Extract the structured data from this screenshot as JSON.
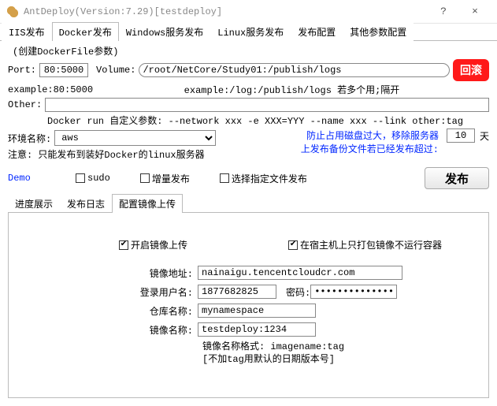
{
  "window": {
    "title": "AntDeploy(Version:7.29)[testdeploy]"
  },
  "main_tabs": [
    "IIS发布",
    "Docker发布",
    "Windows服务发布",
    "Linux服务发布",
    "发布配置",
    "其他参数配置"
  ],
  "docker": {
    "dockerfile_heading": "(创建DockerFile参数)",
    "port_label": "Port:",
    "port_value": "80:5000",
    "port_example": "example:80:5000",
    "volume_label": "Volume:",
    "volume_value": "/root/NetCore/Study01:/publish/logs",
    "volume_example": "example:/log:/publish/logs  若多个用;隔开",
    "rollback": "回滚",
    "other_label": "Other:",
    "other_value": "",
    "other_hint": "Docker run 自定义参数:  --network xxx -e XXX=YYY --name xxx --link other:tag",
    "env_label": "环境名称:",
    "env_value": "aws",
    "env_note": "注意: 只能发布到装好Docker的linux服务器",
    "disk_note1": "防止占用磁盘过大，移除服务器",
    "disk_note2": "上发布备份文件若已经发布超过:",
    "days_value": "10",
    "days_unit": "天",
    "demo": "Demo",
    "sudo": "sudo",
    "incremental": "增量发布",
    "select_files": "选择指定文件发布",
    "publish": "发布"
  },
  "sub_tabs": [
    "进度展示",
    "发布日志",
    "配置镜像上传"
  ],
  "mirror": {
    "enable": "开启镜像上传",
    "pack_only": "在宿主机上只打包镜像不运行容器",
    "addr_label": "镜像地址:",
    "addr_value": "nainaigu.tencentcloudcr.com",
    "user_label": "登录用户名:",
    "user_value": "1877682825",
    "pw_label": "密码:",
    "pw_value": "••••••••••••••",
    "repo_label": "仓库名称:",
    "repo_value": "mynamespace",
    "image_label": "镜像名称:",
    "image_value": "testdeploy:1234",
    "hint1": "镜像名称格式: imagename:tag",
    "hint2": "[不加tag用默认的日期版本号]"
  }
}
